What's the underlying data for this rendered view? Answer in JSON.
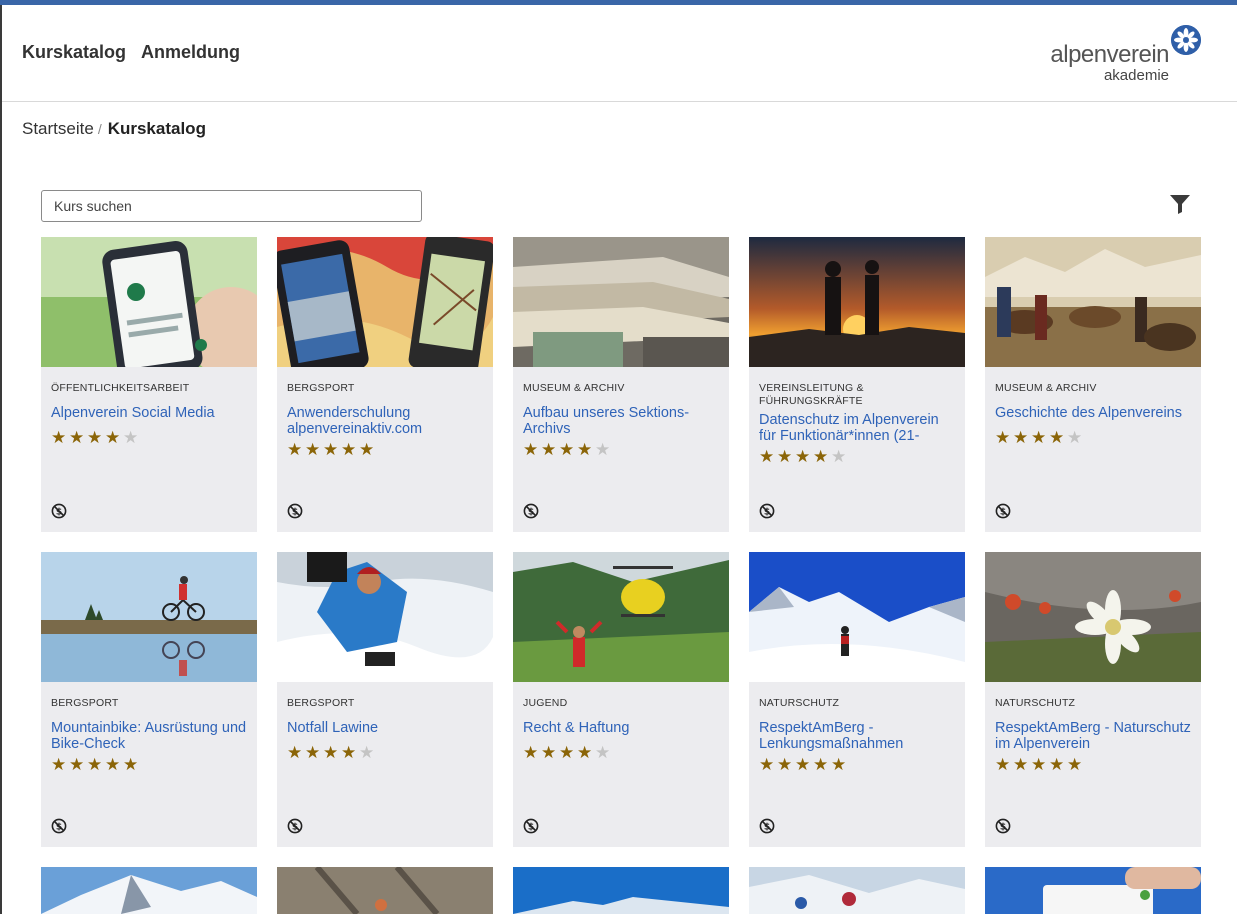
{
  "nav": {
    "catalog": "Kurskatalog",
    "login": "Anmeldung"
  },
  "logo": {
    "main": "alpenverein",
    "sub": "akademie"
  },
  "breadcrumb": {
    "home": "Startseite",
    "separator": "/",
    "current": "Kurskatalog"
  },
  "search": {
    "placeholder": "Kurs suchen"
  },
  "filter_icon": "filter-funnel-icon",
  "accent_color": "#2f63b8",
  "star_color": "#8b6508",
  "courses": [
    {
      "category": "Öffentlichkeitsarbeit",
      "title": "Alpenverein Social Media",
      "rating": 4
    },
    {
      "category": "Bergsport",
      "title": "Anwenderschulung alpenvereinaktiv.com",
      "rating": 5
    },
    {
      "category": "Museum & Archiv",
      "title": "Aufbau unseres Sektions-Archivs",
      "rating": 4
    },
    {
      "category": "Vereinsleitung & Führungskräfte",
      "title": "Datenschutz im Alpenverein für Funktionär*innen (21-",
      "rating": 4
    },
    {
      "category": "Museum & Archiv",
      "title": "Geschichte des Alpenvereins",
      "rating": 4
    },
    {
      "category": "Bergsport",
      "title": "Mountainbike: Ausrüstung und Bike-Check",
      "rating": 5
    },
    {
      "category": "Bergsport",
      "title": "Notfall Lawine",
      "rating": 4
    },
    {
      "category": "Jugend",
      "title": "Recht & Haftung",
      "rating": 4
    },
    {
      "category": "Naturschutz",
      "title": "RespektAmBerg - Lenkungsmaßnahmen",
      "rating": 5
    },
    {
      "category": "Naturschutz",
      "title": "RespektAmBerg - Naturschutz im Alpenverein",
      "rating": 5
    }
  ]
}
